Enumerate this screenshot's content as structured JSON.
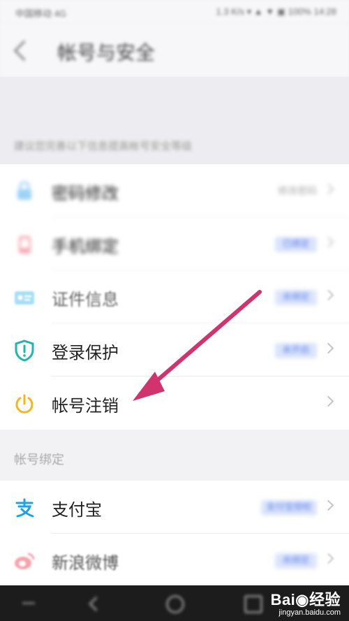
{
  "status_bar": {
    "carrier": "中国移动 4G",
    "right": "1.3 K/s ▾ ▲ ▼ ▣ 100% 14:28"
  },
  "header": {
    "title": "帐号与安全",
    "back_icon": "chevron-left-icon"
  },
  "tip": {
    "text": "建议您完善以下信息提高帐号安全等级"
  },
  "security_items": [
    {
      "label": "密码修改",
      "icon": "lock-icon",
      "value": "修改密码"
    },
    {
      "label": "手机绑定",
      "icon": "phone-icon",
      "badge": "已绑定"
    },
    {
      "label": "证件信息",
      "icon": "id-card-icon",
      "badge": "未绑定"
    },
    {
      "label": "登录保护",
      "icon": "shield-icon",
      "badge": "未开启"
    },
    {
      "label": "帐号注销",
      "icon": "power-icon"
    }
  ],
  "section_binding": {
    "title": "帐号绑定"
  },
  "binding_items": [
    {
      "label": "支付宝",
      "icon": "alipay-icon",
      "badge": "支付宝授权"
    },
    {
      "label": "新浪微博",
      "icon": "weibo-icon",
      "badge": "未绑定"
    }
  ],
  "watermark": {
    "brand": "Bai◉经验",
    "url": "jingyan.baidu.com"
  },
  "colors": {
    "accent_blue": "#5a7ee8",
    "arrow_magenta": "#d1336e",
    "power_yellow": "#f2b71f",
    "shield_teal": "#1fb5b0",
    "alipay_blue": "#1aa3e8",
    "weibo_red": "#e6162d"
  }
}
